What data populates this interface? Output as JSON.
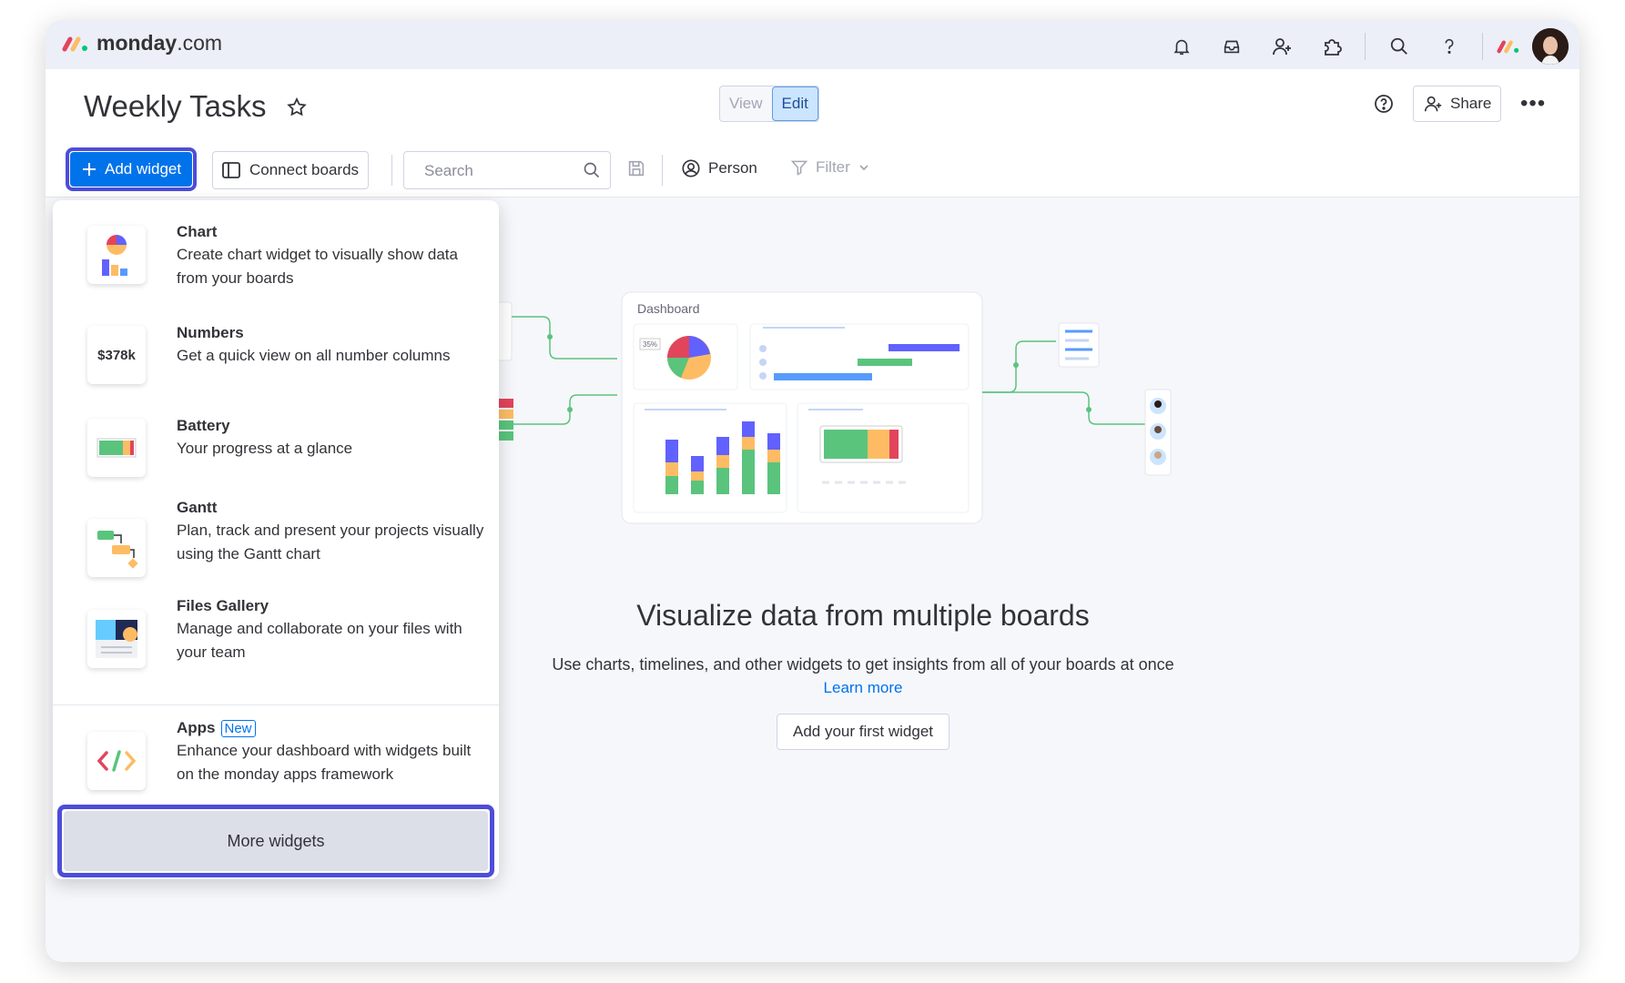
{
  "topbar": {
    "logo_text": "monday",
    "logo_domain": ".com",
    "icons": [
      "bell-icon",
      "inbox-icon",
      "invite-icon",
      "apps-icon",
      "search-icon",
      "help-icon"
    ]
  },
  "header": {
    "title": "Weekly Tasks",
    "view_label": "View",
    "edit_label": "Edit",
    "share_label": "Share"
  },
  "toolbar": {
    "add_widget_label": "Add widget",
    "connect_boards_label": "Connect boards",
    "search_placeholder": "Search",
    "person_label": "Person",
    "filter_label": "Filter"
  },
  "widgets_menu": {
    "items": [
      {
        "title": "Chart",
        "description": "Create chart widget to visually show data from your boards",
        "icon": "chart-icon"
      },
      {
        "title": "Numbers",
        "description": "Get a quick view on all number columns",
        "icon": "numbers-icon",
        "icon_text": "$378k"
      },
      {
        "title": "Battery",
        "description": "Your progress at a glance",
        "icon": "battery-icon"
      },
      {
        "title": "Gantt",
        "description": "Plan, track and present your projects visually using the Gantt chart",
        "icon": "gantt-icon"
      },
      {
        "title": "Files Gallery",
        "description": "Manage and collaborate on your files with your team",
        "icon": "files-gallery-icon"
      },
      {
        "title": "Apps",
        "badge": "New",
        "description": "Enhance your dashboard with widgets built on the monday apps framework",
        "icon": "code-icon"
      }
    ],
    "more_label": "More widgets"
  },
  "empty_state": {
    "illustration_title": "Dashboard",
    "illustration_percent": "35%",
    "title": "Visualize data from multiple boards",
    "description": "Use charts, timelines, and other widgets to get insights from all of your boards at once",
    "learn_more": "Learn more",
    "cta": "Add your first widget"
  },
  "colors": {
    "primary": "#0073ea",
    "highlight_border": "#4d4dd9",
    "green": "#5ac47d",
    "yellow": "#fdbc64",
    "red": "#e2445c",
    "purple": "#6161ff"
  }
}
